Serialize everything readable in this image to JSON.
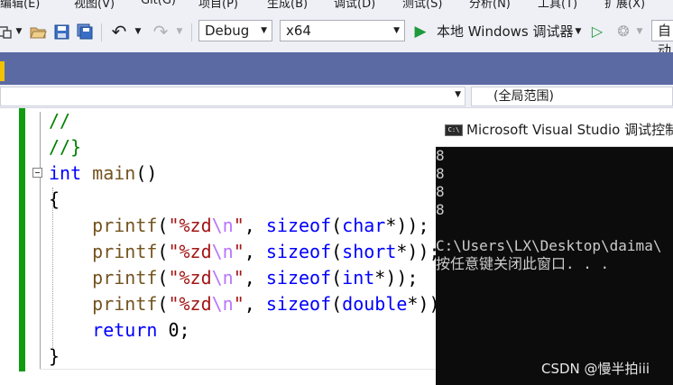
{
  "menu": [
    "编辑(E)",
    "视图(V)",
    "Git(G)",
    "项目(P)",
    "生成(B)",
    "调试(D)",
    "测试(S)",
    "分析(N)",
    "工具(T)",
    "扩展(X)"
  ],
  "toolbar": {
    "configuration": "Debug",
    "platform": "x64",
    "run_label": "本地 Windows 调试器",
    "extra_combo": "自动"
  },
  "navbar": {
    "scope": "(全局范围)"
  },
  "code": {
    "lines": [
      {
        "parts": [
          {
            "c": "cm",
            "t": "//"
          }
        ]
      },
      {
        "parts": [
          {
            "c": "cm",
            "t": "//}"
          }
        ]
      },
      {
        "parts": [
          {
            "c": "kw",
            "t": "int"
          },
          {
            "c": "op",
            "t": " "
          },
          {
            "c": "fn",
            "t": "main"
          },
          {
            "c": "op",
            "t": "()"
          }
        ]
      },
      {
        "parts": [
          {
            "c": "op",
            "t": "{"
          }
        ]
      },
      {
        "parts": [
          {
            "c": "op",
            "t": "    "
          },
          {
            "c": "fn",
            "t": "printf"
          },
          {
            "c": "op",
            "t": "("
          },
          {
            "c": "st",
            "t": "\"%zd"
          },
          {
            "c": "esc",
            "t": "\\n"
          },
          {
            "c": "st",
            "t": "\""
          },
          {
            "c": "op",
            "t": ", "
          },
          {
            "c": "kw",
            "t": "sizeof"
          },
          {
            "c": "op",
            "t": "("
          },
          {
            "c": "kw",
            "t": "char"
          },
          {
            "c": "op",
            "t": "*));"
          }
        ]
      },
      {
        "parts": [
          {
            "c": "op",
            "t": "    "
          },
          {
            "c": "fn",
            "t": "printf"
          },
          {
            "c": "op",
            "t": "("
          },
          {
            "c": "st",
            "t": "\"%zd"
          },
          {
            "c": "esc",
            "t": "\\n"
          },
          {
            "c": "st",
            "t": "\""
          },
          {
            "c": "op",
            "t": ", "
          },
          {
            "c": "kw",
            "t": "sizeof"
          },
          {
            "c": "op",
            "t": "("
          },
          {
            "c": "kw",
            "t": "short"
          },
          {
            "c": "op",
            "t": "*));"
          }
        ]
      },
      {
        "parts": [
          {
            "c": "op",
            "t": "    "
          },
          {
            "c": "fn",
            "t": "printf"
          },
          {
            "c": "op",
            "t": "("
          },
          {
            "c": "st",
            "t": "\"%zd"
          },
          {
            "c": "esc",
            "t": "\\n"
          },
          {
            "c": "st",
            "t": "\""
          },
          {
            "c": "op",
            "t": ", "
          },
          {
            "c": "kw",
            "t": "sizeof"
          },
          {
            "c": "op",
            "t": "("
          },
          {
            "c": "kw",
            "t": "int"
          },
          {
            "c": "op",
            "t": "*));"
          }
        ]
      },
      {
        "parts": [
          {
            "c": "op",
            "t": "    "
          },
          {
            "c": "fn",
            "t": "printf"
          },
          {
            "c": "op",
            "t": "("
          },
          {
            "c": "st",
            "t": "\"%zd"
          },
          {
            "c": "esc",
            "t": "\\n"
          },
          {
            "c": "st",
            "t": "\""
          },
          {
            "c": "op",
            "t": ", "
          },
          {
            "c": "kw",
            "t": "sizeof"
          },
          {
            "c": "op",
            "t": "("
          },
          {
            "c": "kw",
            "t": "double"
          },
          {
            "c": "op",
            "t": "*));"
          }
        ]
      },
      {
        "parts": [
          {
            "c": "op",
            "t": "    "
          },
          {
            "c": "kw",
            "t": "return"
          },
          {
            "c": "op",
            "t": " 0;"
          }
        ]
      },
      {
        "parts": [
          {
            "c": "op",
            "t": "}"
          }
        ]
      }
    ]
  },
  "console": {
    "title": "Microsoft Visual Studio 调试控制台",
    "output": [
      "8",
      "8",
      "8",
      "8",
      "",
      "C:\\Users\\LX\\Desktop\\daima\\",
      "按任意键关闭此窗口. . ."
    ]
  },
  "watermark": "CSDN @慢半拍iii",
  "colors": {
    "tab_strip": "#5c6aa4",
    "change_bar": "#109c10",
    "keyword": "#0000ff",
    "string": "#a31515",
    "comment": "#008000",
    "function": "#74531f",
    "escape": "#b776fb",
    "console_bg": "#0c0c0c"
  }
}
